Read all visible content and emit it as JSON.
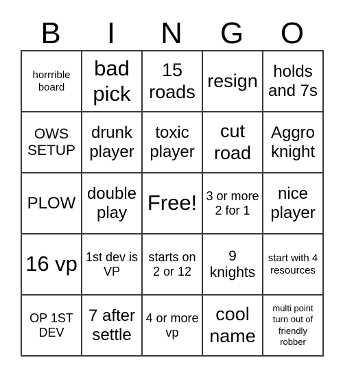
{
  "card": {
    "headers": [
      "B",
      "I",
      "N",
      "G",
      "O"
    ],
    "free_space_label": "Free!",
    "colors": {
      "border": "#3a3a3a",
      "text": "#000000",
      "background": "#ffffff"
    },
    "rows": [
      [
        {
          "text": "horrrible board",
          "size": "xs"
        },
        {
          "text": "bad pick",
          "size": "xxl"
        },
        {
          "text": "15 roads",
          "size": "xl"
        },
        {
          "text": "resign",
          "size": "xl"
        },
        {
          "text": "holds and 7s",
          "size": "l"
        }
      ],
      [
        {
          "text": "OWS SETUP",
          "size": "m"
        },
        {
          "text": "drunk player",
          "size": "l"
        },
        {
          "text": "toxic player",
          "size": "l"
        },
        {
          "text": "cut road",
          "size": "xl"
        },
        {
          "text": "Aggro knight",
          "size": "l"
        }
      ],
      [
        {
          "text": "PLOW",
          "size": "l"
        },
        {
          "text": "double play",
          "size": "l"
        },
        {
          "text": "Free!",
          "size": "xxl"
        },
        {
          "text": "3 or more 2 for 1",
          "size": "s"
        },
        {
          "text": "nice player",
          "size": "l"
        }
      ],
      [
        {
          "text": "16 vp",
          "size": "xxl"
        },
        {
          "text": "1st dev is VP",
          "size": "s"
        },
        {
          "text": "starts on 2 or 12",
          "size": "s"
        },
        {
          "text": "9 knights",
          "size": "m"
        },
        {
          "text": "start with 4 resources",
          "size": "xs"
        }
      ],
      [
        {
          "text": "OP 1ST DEV",
          "size": "s"
        },
        {
          "text": "7 after settle",
          "size": "l"
        },
        {
          "text": "4 or more vp",
          "size": "s"
        },
        {
          "text": "cool name",
          "size": "xl"
        },
        {
          "text": "multi point turn out of friendly robber",
          "size": "xxs"
        }
      ]
    ]
  }
}
